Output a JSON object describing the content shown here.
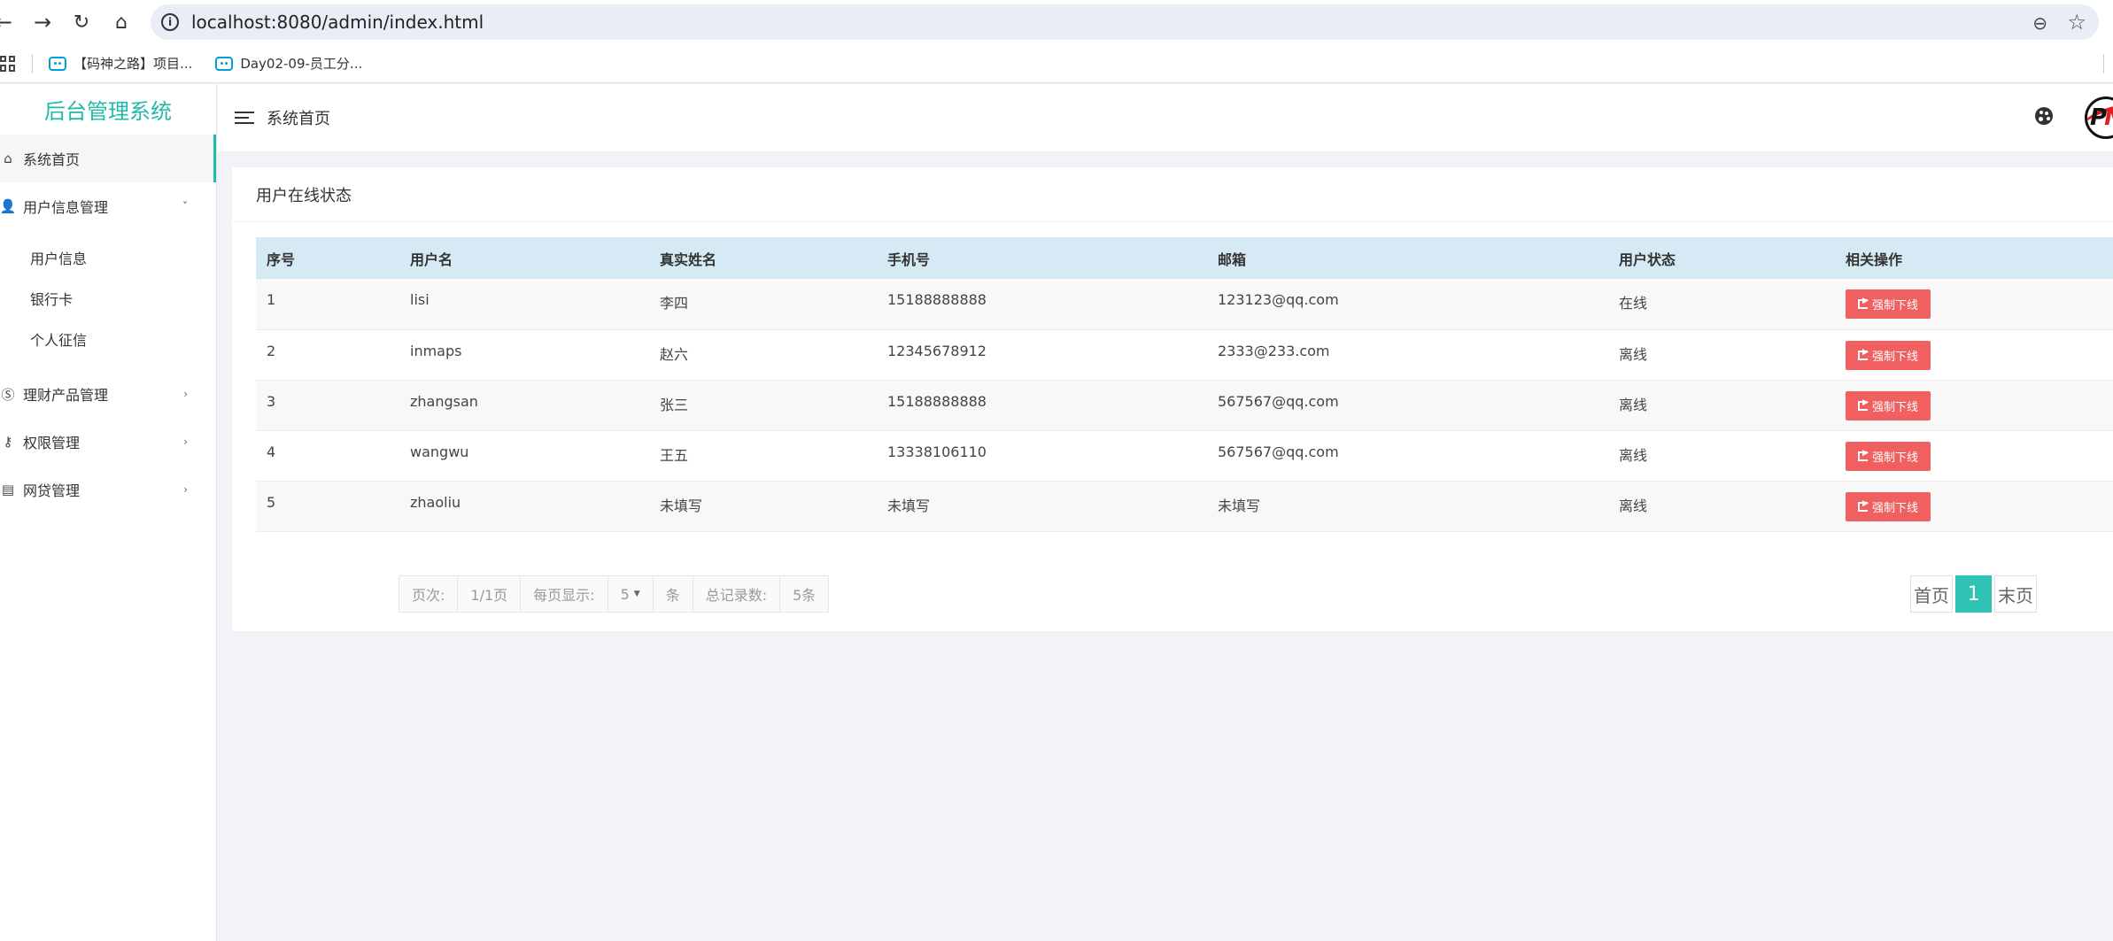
{
  "browser": {
    "url": "localhost:8080/admin/index.html",
    "bookmarks": [
      {
        "label": "【码神之路】项目..."
      },
      {
        "label": "Day02-09-员工分..."
      }
    ]
  },
  "sidebar": {
    "title": "后台管理系统",
    "menu": {
      "home": {
        "label": "系统首页",
        "icon": "home-icon"
      },
      "user_info_mgmt": {
        "label": "用户信息管理",
        "icon": "user-gear-icon",
        "sub": [
          {
            "label": "用户信息"
          },
          {
            "label": "银行卡"
          },
          {
            "label": "个人征信"
          }
        ]
      },
      "finance_products": {
        "label": "理财产品管理",
        "icon": "coin-icon"
      },
      "permissions": {
        "label": "权限管理",
        "icon": "key-icon"
      },
      "loans": {
        "label": "网贷管理",
        "icon": "message-icon"
      }
    }
  },
  "header": {
    "title": "系统首页"
  },
  "card": {
    "title": "用户在线状态",
    "columns": [
      "序号",
      "用户名",
      "真实姓名",
      "手机号",
      "邮箱",
      "用户状态",
      "相关操作"
    ],
    "action_label": "强制下线",
    "rows": [
      {
        "id": "1",
        "username": "lisi",
        "realname": "李四",
        "phone": "15188888888",
        "email": "123123@qq.com",
        "status": "在线"
      },
      {
        "id": "2",
        "username": "inmaps",
        "realname": "赵六",
        "phone": "12345678912",
        "email": "2333@233.com",
        "status": "离线"
      },
      {
        "id": "3",
        "username": "zhangsan",
        "realname": "张三",
        "phone": "15188888888",
        "email": "567567@qq.com",
        "status": "离线"
      },
      {
        "id": "4",
        "username": "wangwu",
        "realname": "王五",
        "phone": "13338106110",
        "email": "567567@qq.com",
        "status": "离线"
      },
      {
        "id": "5",
        "username": "zhaoliu",
        "realname": "未填写",
        "phone": "未填写",
        "email": "未填写",
        "status": "离线"
      }
    ]
  },
  "pagination": {
    "page_label": "页次:",
    "page_value": "1/1页",
    "per_page_label": "每页显示:",
    "per_page_value": "5",
    "per_page_unit": "条",
    "total_label": "总记录数:",
    "total_value": "5条",
    "first": "首页",
    "current": "1",
    "last": "末页"
  },
  "colors": {
    "accent": "#1fbba6",
    "danger": "#f06060",
    "table_header": "#d6eaf5"
  }
}
